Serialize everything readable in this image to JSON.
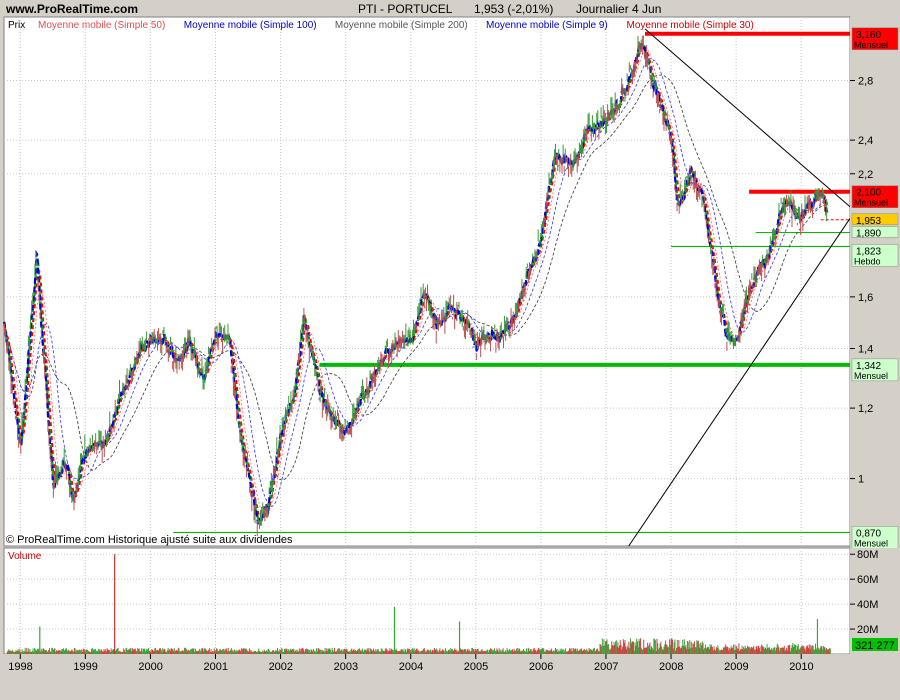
{
  "header": {
    "site": "www.ProRealTime.com",
    "instrument": "PTI - PORTUCEL",
    "quote": "1,953 (-2,01%)",
    "period": "Journalier  4 Jun"
  },
  "legend": {
    "price_label": "Prix",
    "items": [
      {
        "label": "Moyenne mobile (Simple 50)",
        "color": "#e05050"
      },
      {
        "label": "Moyenne mobile (Simple 100)",
        "color": "#0000cc"
      },
      {
        "label": "Moyenne mobile (Simple 200)",
        "color": "#555555"
      },
      {
        "label": "Moyenne mobile (Simple 9)",
        "color": "#0000cc"
      },
      {
        "label": "Moyenne mobile (Simple 30)",
        "color": "#cc0000"
      }
    ]
  },
  "watermark": "© ProRealTime.com  Historique ajusté suite aux dividendes",
  "volume_label": "Volume",
  "colors": {
    "background": "#ffffff",
    "grid": "#c8c8c8",
    "ma9": "#0000dd",
    "ma30": "#ff0000",
    "ma_green": "#00b000",
    "ma200": "#333333",
    "resistance": "#ff0000",
    "support": "#00bb00",
    "trendline": "#000000"
  },
  "chart_data": [
    {
      "type": "line",
      "title": "PTI - PORTUCEL",
      "scale": "log",
      "ylim": [
        0.84,
        3.3
      ],
      "xlim": [
        1997.75,
        2010.75
      ],
      "y_ticks": [
        {
          "value": 2.8,
          "label": "2,8"
        },
        {
          "value": 2.4,
          "label": "2,4"
        },
        {
          "value": 2.2,
          "label": "2,2"
        },
        {
          "value": 1.6,
          "label": "1,6"
        },
        {
          "value": 1.4,
          "label": "1,4"
        },
        {
          "value": 1.2,
          "label": "1,2"
        },
        {
          "value": 1.0,
          "label": "1"
        }
      ],
      "x_ticks": [
        "1998",
        "1999",
        "2000",
        "2001",
        "2002",
        "2003",
        "2004",
        "2005",
        "2006",
        "2007",
        "2008",
        "2009",
        "2010"
      ],
      "series": [
        {
          "name": "Prix",
          "x": [
            1997.75,
            1998.0,
            1998.25,
            1998.3,
            1998.5,
            1998.7,
            1998.8,
            1999.0,
            1999.3,
            1999.5,
            1999.8,
            2000.0,
            2000.2,
            2000.4,
            2000.6,
            2000.8,
            2001.0,
            2001.2,
            2001.35,
            2001.55,
            2001.65,
            2001.8,
            2002.0,
            2002.2,
            2002.35,
            2002.6,
            2002.75,
            2003.0,
            2003.3,
            2003.6,
            2003.9,
            2004.0,
            2004.2,
            2004.4,
            2004.6,
            2004.8,
            2005.0,
            2005.2,
            2005.4,
            2005.6,
            2005.8,
            2006.0,
            2006.2,
            2006.3,
            2006.5,
            2006.7,
            2006.9,
            2007.1,
            2007.3,
            2007.5,
            2007.55,
            2007.7,
            2007.9,
            2008.0,
            2008.1,
            2008.3,
            2008.5,
            2008.7,
            2008.85,
            2009.0,
            2009.15,
            2009.3,
            2009.5,
            2009.7,
            2009.8,
            2009.9,
            2010.0,
            2010.1,
            2010.2,
            2010.3,
            2010.4
          ],
          "values": [
            1.5,
            1.08,
            1.8,
            1.55,
            0.98,
            1.05,
            0.95,
            1.08,
            1.09,
            1.22,
            1.38,
            1.43,
            1.43,
            1.36,
            1.42,
            1.3,
            1.45,
            1.45,
            1.15,
            0.97,
            0.9,
            0.93,
            1.12,
            1.25,
            1.52,
            1.25,
            1.18,
            1.13,
            1.25,
            1.38,
            1.45,
            1.41,
            1.63,
            1.48,
            1.55,
            1.52,
            1.41,
            1.45,
            1.45,
            1.52,
            1.72,
            1.85,
            2.32,
            2.28,
            2.25,
            2.45,
            2.5,
            2.6,
            2.73,
            3.05,
            3.1,
            2.82,
            2.55,
            2.42,
            2.0,
            2.22,
            2.05,
            1.62,
            1.45,
            1.42,
            1.6,
            1.7,
            1.78,
            2.02,
            2.05,
            1.98,
            1.97,
            2.03,
            2.06,
            2.1,
            1.953
          ]
        }
      ],
      "levels": [
        {
          "value": 3.16,
          "label": "3,160",
          "sub": "Mensuel",
          "color": "#ff0000"
        },
        {
          "value": 2.1,
          "label": "2,100",
          "sub": "Mensuel",
          "color": "#ff0000"
        },
        {
          "value": 1.953,
          "label": "1,953",
          "sub": "",
          "color": "#ffcc00"
        },
        {
          "value": 1.89,
          "label": "1,890",
          "sub": "",
          "color": "#ccffcc"
        },
        {
          "value": 1.823,
          "label": "1,823",
          "sub": "Hebdo",
          "color": "#ccffcc"
        },
        {
          "value": 1.342,
          "label": "1,342",
          "sub": "Mensuel",
          "color": "#ccffcc"
        },
        {
          "value": 0.87,
          "label": "0,870",
          "sub": "Mensuel",
          "color": "#ccffcc"
        }
      ]
    },
    {
      "type": "bar",
      "title": "Volume",
      "ylim": [
        0,
        85000000
      ],
      "y_ticks": [
        {
          "value": 80000000,
          "label": "80M"
        },
        {
          "value": 60000000,
          "label": "60M"
        },
        {
          "value": 40000000,
          "label": "40M"
        },
        {
          "value": 20000000,
          "label": "20M"
        }
      ],
      "last_value": "321 277",
      "spikes": [
        {
          "x": 1999.45,
          "value": 80000000
        },
        {
          "x": 1998.3,
          "value": 22000000
        },
        {
          "x": 2003.75,
          "value": 38000000
        },
        {
          "x": 2004.75,
          "value": 26000000
        },
        {
          "x": 2010.25,
          "value": 28000000
        }
      ]
    }
  ]
}
